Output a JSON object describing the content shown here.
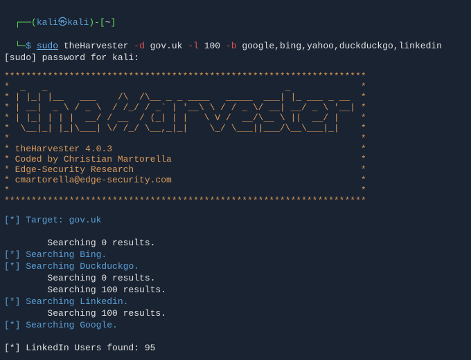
{
  "prompt": {
    "segment_open": "┌──(",
    "user": "kali",
    "at": "㉿",
    "host": "kali",
    "segment_close": ")-[",
    "path": "~",
    "segment_end": "]",
    "line2_prefix": "└─",
    "dollar": "$ ",
    "sudo": "sudo",
    "cmd": " theHarvester ",
    "flag_d": "-d",
    "arg_d": " gov.uk ",
    "flag_l": "-l",
    "arg_l": " 100 ",
    "flag_b": "-b",
    "arg_b": " google,bing,yahoo,duckduckgo,linkedin"
  },
  "password_prompt": "[sudo] password for kali:",
  "ascii": {
    "l0": "*******************************************************************",
    "l1": "*  _   _                                            _             *",
    "l2": "* | |_| |__   ___    /\\  /\\__ _ _ ____   _____  ___| |_ ___ _ __  *",
    "l3": "* | __|  _ \\ / _ \\  / /_/ / _` | '__\\ \\ / / _ \\/ __| __/ _ \\ '__| *",
    "l4": "* | |_| | | |  __/ / __  / (_| | |   \\ V /  __/\\__ \\ ||  __/ |    *",
    "l5": "*  \\__|_| |_|\\___| \\/ /_/ \\__,_|_|    \\_/ \\___||___/\\__\\___|_|    *",
    "l6": "*                                                                 *",
    "l7": "* theHarvester 4.0.3                                              *",
    "l8": "* Coded by Christian Martorella                                   *",
    "l9": "* Edge-Security Research                                          *",
    "l10": "* cmartorella@edge-security.com                                   *",
    "l11": "*                                                                 *",
    "l12": "*******************************************************************"
  },
  "output": {
    "target_prefix": "[*] ",
    "target_label": "Target: gov.uk",
    "blank": "",
    "searching0_indent": "        Searching 0 results.",
    "searching_bing_prefix": "[*] ",
    "searching_bing": "Searching Bing.",
    "searching_ddg_prefix": "[*] ",
    "searching_ddg": "Searching Duckduckgo.",
    "searching0b_indent": "        Searching 0 results.",
    "searching100_indent": "        Searching 100 results.",
    "searching_li_prefix": "[*] ",
    "searching_li": "Searching Linkedin.",
    "searching100b_indent": "        Searching 100 results.",
    "searching_google_prefix": "[*] ",
    "searching_google": "Searching Google.",
    "linkedin_found": "[*] LinkedIn Users found: 95"
  }
}
